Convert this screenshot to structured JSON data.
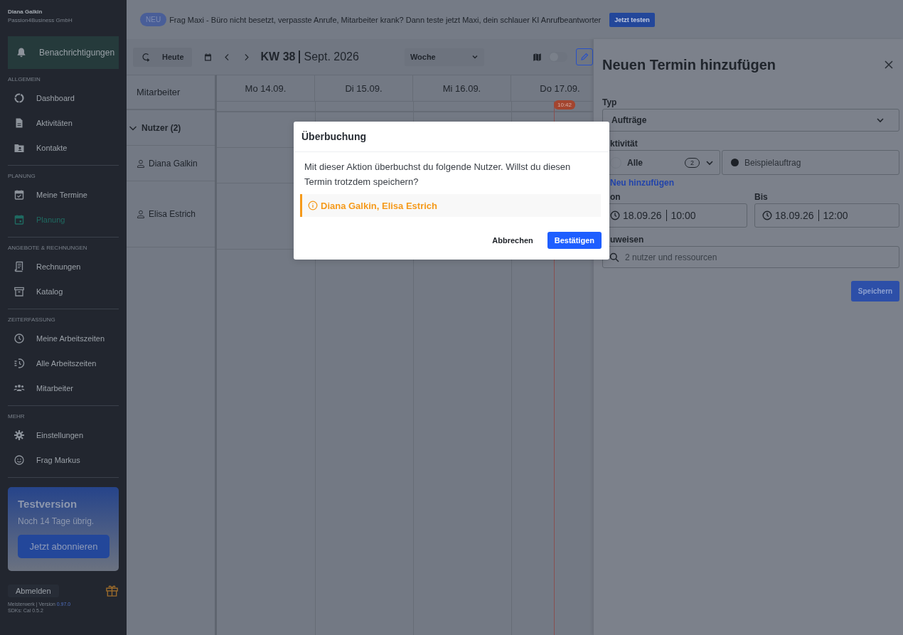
{
  "sidebar": {
    "user": "Diana Galkin",
    "company": "Passion4Business GmbH",
    "notifications": {
      "label": "Benachrichtigungen"
    },
    "sections": [
      {
        "title": "ALLGEMEIN",
        "items": [
          {
            "label": "Dashboard",
            "selected": false
          },
          {
            "label": "Aktivitäten",
            "selected": false
          },
          {
            "label": "Kontakte",
            "selected": false
          }
        ]
      },
      {
        "title": "PLANUNG",
        "items": [
          {
            "label": "Meine Termine",
            "selected": false
          },
          {
            "label": "Planung",
            "selected": true
          }
        ]
      },
      {
        "title": "ANGEBOTE & RECHNUNGEN",
        "items": [
          {
            "label": "Rechnungen",
            "selected": false
          },
          {
            "label": "Katalog",
            "selected": false
          }
        ]
      },
      {
        "title": "ZEITERFASSUNG",
        "items": [
          {
            "label": "Meine Arbeitszeiten",
            "selected": false
          },
          {
            "label": "Alle Arbeitszeiten",
            "selected": false
          },
          {
            "label": "Mitarbeiter",
            "selected": false
          }
        ]
      },
      {
        "title": "MEHR",
        "items": [
          {
            "label": "Einstellungen",
            "selected": false
          },
          {
            "label": "Frag Markus",
            "selected": false
          }
        ]
      }
    ],
    "trial": {
      "title": "Testversion",
      "text": "Noch 14 Tage übrig.",
      "button": "Jetzt abonnieren"
    },
    "logout": "Abmelden",
    "version_label": "Meisterwerk | Version",
    "version": "0.97.0",
    "sdks": "SDKs: Cal 0.5.2"
  },
  "banner": {
    "badge": "NEU",
    "text": "Frag Maxi - Büro nicht besetzt, verpasste Anrufe, Mitarbeiter krank? Dann teste jetzt Maxi, dein schlauer KI Anrufbeantworter",
    "button": "Jetzt testen"
  },
  "toolbar": {
    "today": "Heute",
    "week": "KW 38",
    "month": "Sept. 2026",
    "view": "Woche",
    "map_toggle": {
      "on": false
    }
  },
  "calendar": {
    "resource_header": "Mitarbeiter",
    "days": [
      "Mo 14.09.",
      "Di 15.09.",
      "Mi 16.09.",
      "Do 17.09."
    ],
    "now": "10:42",
    "groups": [
      {
        "label": "Nutzer (2)",
        "expanded": true,
        "members": [
          "Diana Galkin",
          "Elisa Estrich"
        ]
      }
    ]
  },
  "panel": {
    "title": "Neuen Termin hinzufügen",
    "type_label": "Typ",
    "type_value": "Aufträge",
    "activity_label": "ktivität",
    "activity_filter": "Alle",
    "activity_count": "2",
    "activity_value": "Beispielauftrag",
    "add_new": "Neu hinzufügen",
    "from_label": "on",
    "from_date": "18.09.26",
    "from_time": "10:00",
    "to_label": "Bis",
    "to_date": "18.09.26",
    "to_time": "12:00",
    "assign_label": "uweisen",
    "assign_placeholder": "2 nutzer und ressourcen",
    "save": "Speichern"
  },
  "dialog": {
    "title": "Überbuchung",
    "message": "Mit dieser Aktion überbuchst du folgende Nutzer. Willst du diesen Termin trotzdem speichern?",
    "warning": "Diana Galkin, Elisa Estrich",
    "cancel": "Abbrechen",
    "confirm": "Bestätigen"
  }
}
